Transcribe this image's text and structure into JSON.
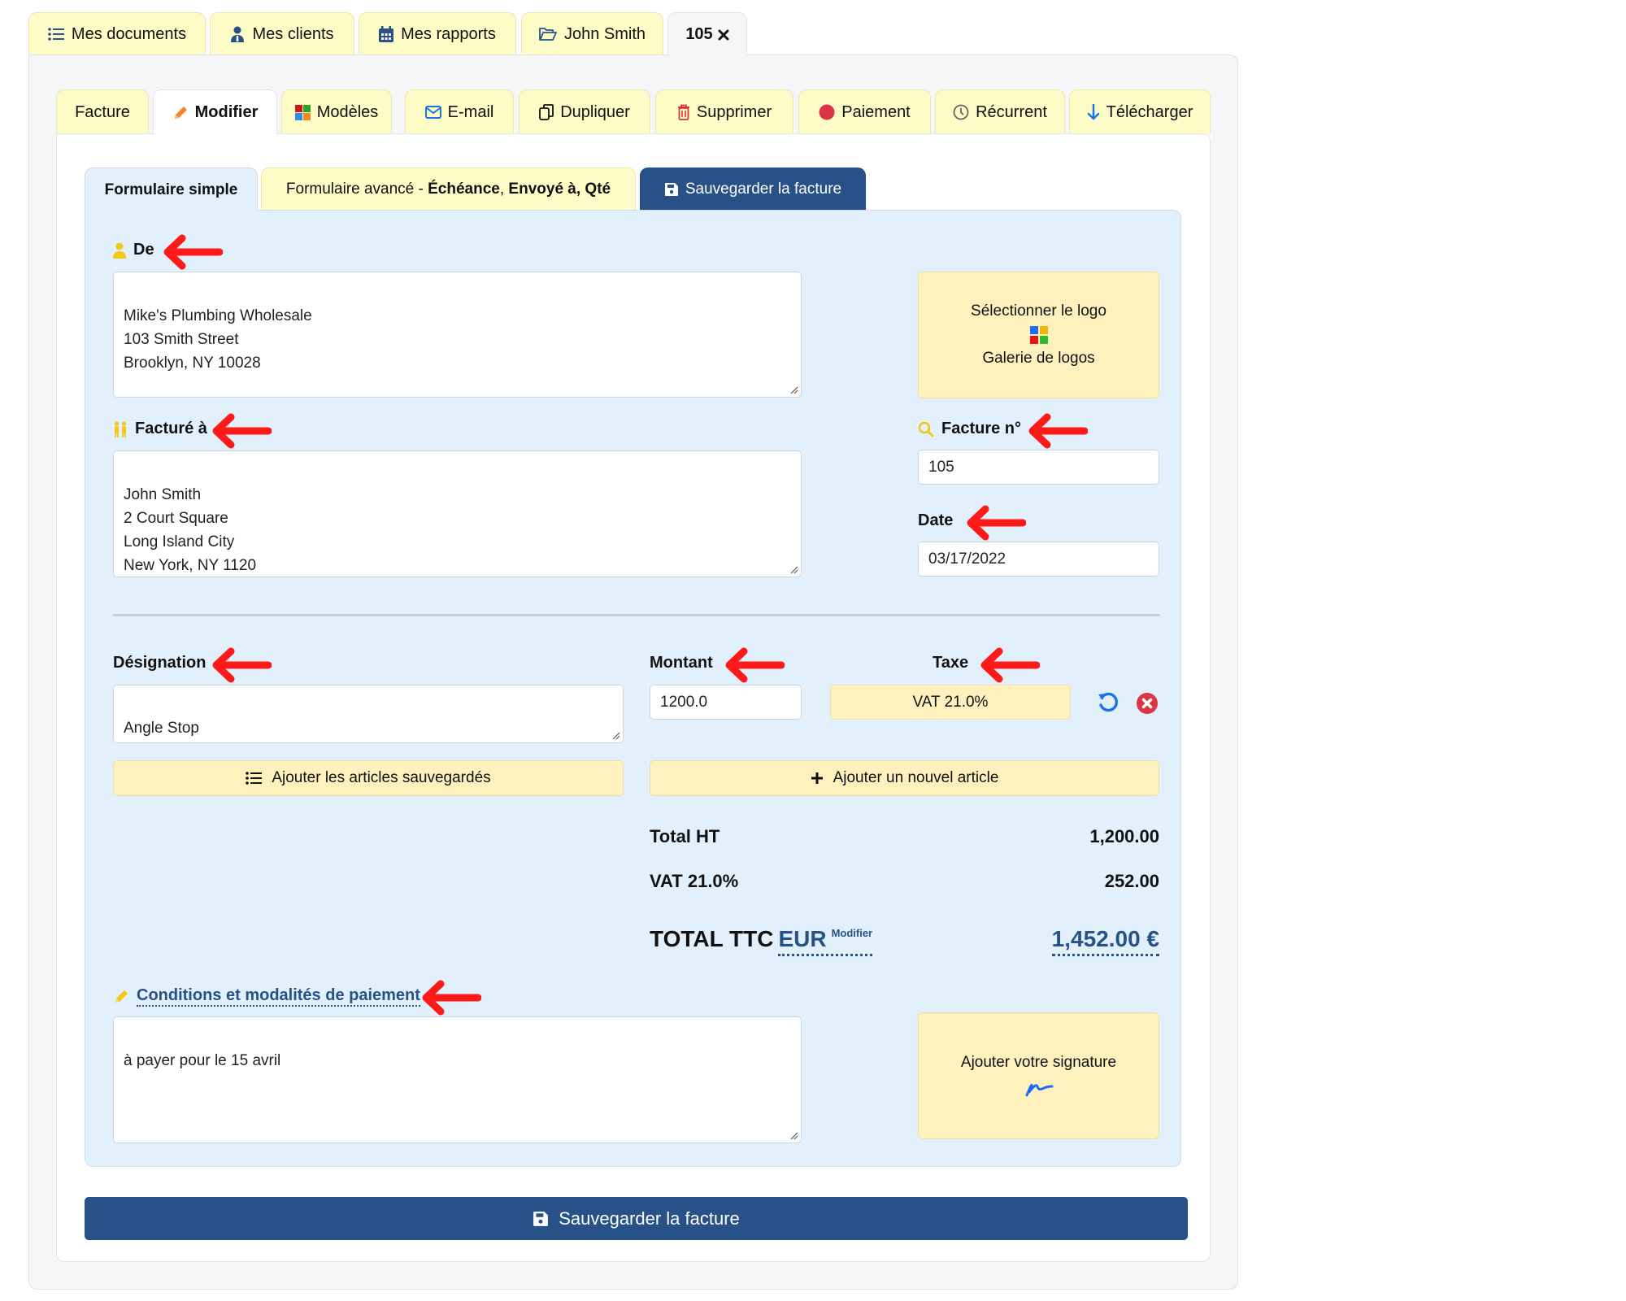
{
  "top_tabs": [
    {
      "label": "Mes documents",
      "icon": "list-icon"
    },
    {
      "label": "Mes clients",
      "icon": "user-tie-icon"
    },
    {
      "label": "Mes rapports",
      "icon": "calendar-icon"
    },
    {
      "label": "John Smith",
      "icon": "folder-open-icon"
    },
    {
      "label": "105",
      "icon": "close-icon",
      "active": true
    }
  ],
  "sub_tabs": [
    {
      "label": "Facture"
    },
    {
      "label": "Modifier",
      "icon": "pencil-icon",
      "active": true
    },
    {
      "label": "Modèles",
      "icon": "templates-grid-icon"
    },
    {
      "label": "E-mail",
      "icon": "envelope-icon"
    },
    {
      "label": "Dupliquer",
      "icon": "copy-icon"
    },
    {
      "label": "Supprimer",
      "icon": "trash-icon"
    },
    {
      "label": "Paiement",
      "icon": "status-dot-icon"
    },
    {
      "label": "Récurrent",
      "icon": "clock-icon"
    },
    {
      "label": "Télécharger",
      "icon": "download-arrow-icon"
    }
  ],
  "form_tabs": {
    "simple": "Formulaire simple",
    "advanced_prefix": "Formulaire avancé - ",
    "advanced_bold_1": "Échéance",
    "advanced_sep": ", ",
    "advanced_bold_2": "Envoyé à, Qté",
    "save": "Sauvegarder la facture"
  },
  "from": {
    "label": "De",
    "value": "Mike's Plumbing Wholesale\n103 Smith Street\nBrooklyn, NY 10028"
  },
  "logo": {
    "select_label": "Sélectionner le logo",
    "gallery_label": "Galerie de logos"
  },
  "bill_to": {
    "label": "Facturé à",
    "value": "John Smith\n2 Court Square\nLong Island City\nNew York, NY 1120"
  },
  "invoice_number": {
    "label": "Facture n°",
    "value": "105"
  },
  "date": {
    "label": "Date",
    "value": "03/17/2022"
  },
  "line_item": {
    "designation_label": "Désignation",
    "designation_value": "Angle Stop",
    "amount_label": "Montant",
    "amount_value": "1200.0",
    "tax_label": "Taxe",
    "tax_value": "VAT 21.0%"
  },
  "buttons": {
    "add_saved_items": "Ajouter les articles sauvegardés",
    "add_new_item": "Ajouter un nouvel article",
    "save_invoice": "Sauvegarder la facture"
  },
  "totals": {
    "subtotal_label": "Total HT",
    "subtotal_value": "1,200.00",
    "tax_label": "VAT 21.0%",
    "tax_value": "252.00",
    "total_label": "TOTAL TTC",
    "currency": "EUR",
    "currency_modify": "Modifier",
    "total_value": "1,452.00 €"
  },
  "terms": {
    "label": "Conditions et modalités de paiement",
    "value": "à payer pour le 15 avril"
  },
  "signature": {
    "label": "Ajouter votre signature"
  },
  "colors": {
    "accent_blue": "#275187",
    "tab_yellow": "#fefcc6",
    "panel_blue": "#e1f0fb",
    "box_yellow": "#fff1bd",
    "annotation_red": "#ff1a1a"
  }
}
